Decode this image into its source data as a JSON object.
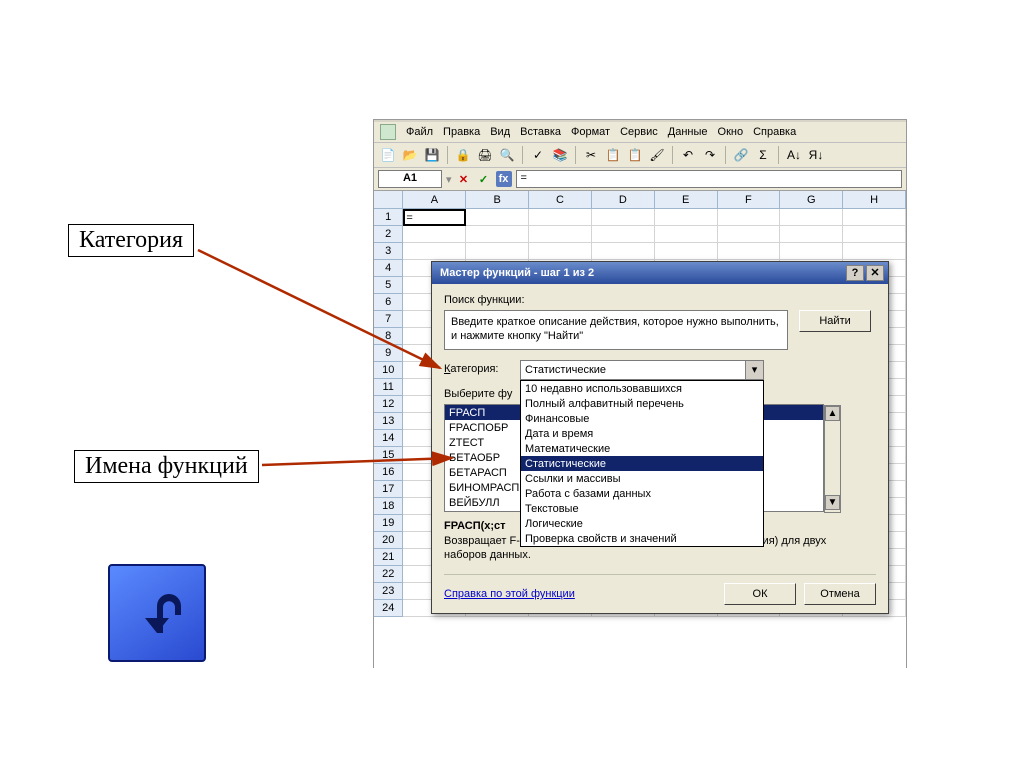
{
  "annotations": {
    "category": "Категория",
    "functions": "Имена функций"
  },
  "back_icon": "return-icon",
  "menu": {
    "items": [
      "Файл",
      "Правка",
      "Вид",
      "Вставка",
      "Формат",
      "Сервис",
      "Данные",
      "Окно",
      "Справка"
    ]
  },
  "toolbar": {
    "buttons": [
      "new",
      "open",
      "save",
      "perm",
      "print",
      "preview",
      "spelling",
      "research",
      "cut",
      "copy",
      "paste",
      "fmtpaint",
      "undo",
      "redo",
      "link",
      "autosum",
      "sort-asc",
      "sort-desc"
    ]
  },
  "formula": {
    "namebox": "A1",
    "cancel": "✕",
    "accept": "✓",
    "fx": "fx",
    "value": "="
  },
  "sheet": {
    "cols": [
      "A",
      "B",
      "C",
      "D",
      "E",
      "F",
      "G",
      "H"
    ],
    "rows": [
      "1",
      "2",
      "3",
      "4",
      "5",
      "6",
      "7",
      "8",
      "9",
      "10",
      "11",
      "12",
      "13",
      "14",
      "15",
      "16",
      "17",
      "18",
      "19",
      "20",
      "21",
      "22",
      "23",
      "24"
    ],
    "a1": "="
  },
  "dialog": {
    "title": "Мастер функций - шаг 1 из 2",
    "help_btn": "?",
    "close_btn": "✕",
    "search_label": "Поиск функции:",
    "search_hint": "Введите краткое описание действия, которое нужно выполнить, и нажмите кнопку \"Найти\"",
    "find_btn": "Найти",
    "category_label": "Категория:",
    "category_value": "Статистические",
    "category_options": [
      "10 недавно использовавшихся",
      "Полный алфавитный перечень",
      "Финансовые",
      "Дата и время",
      "Математические",
      "Статистические",
      "Ссылки и массивы",
      "Работа с базами данных",
      "Текстовые",
      "Логические",
      "Проверка свойств и значений"
    ],
    "select_label_short": "Выберите фу",
    "functions": [
      "FРАСП",
      "FРАСПОБР",
      "ZТЕСТ",
      "БЕТАОБР",
      "БЕТАРАСП",
      "БИНОМРАСП",
      "ВЕЙБУЛЛ"
    ],
    "signature": "FРАСП(x;ст",
    "description": "Возвращает F-распределение вероятности (степень отклонения) для двух наборов данных.",
    "help_link": "Справка по этой функции",
    "ok": "ОК",
    "cancel": "Отмена"
  }
}
